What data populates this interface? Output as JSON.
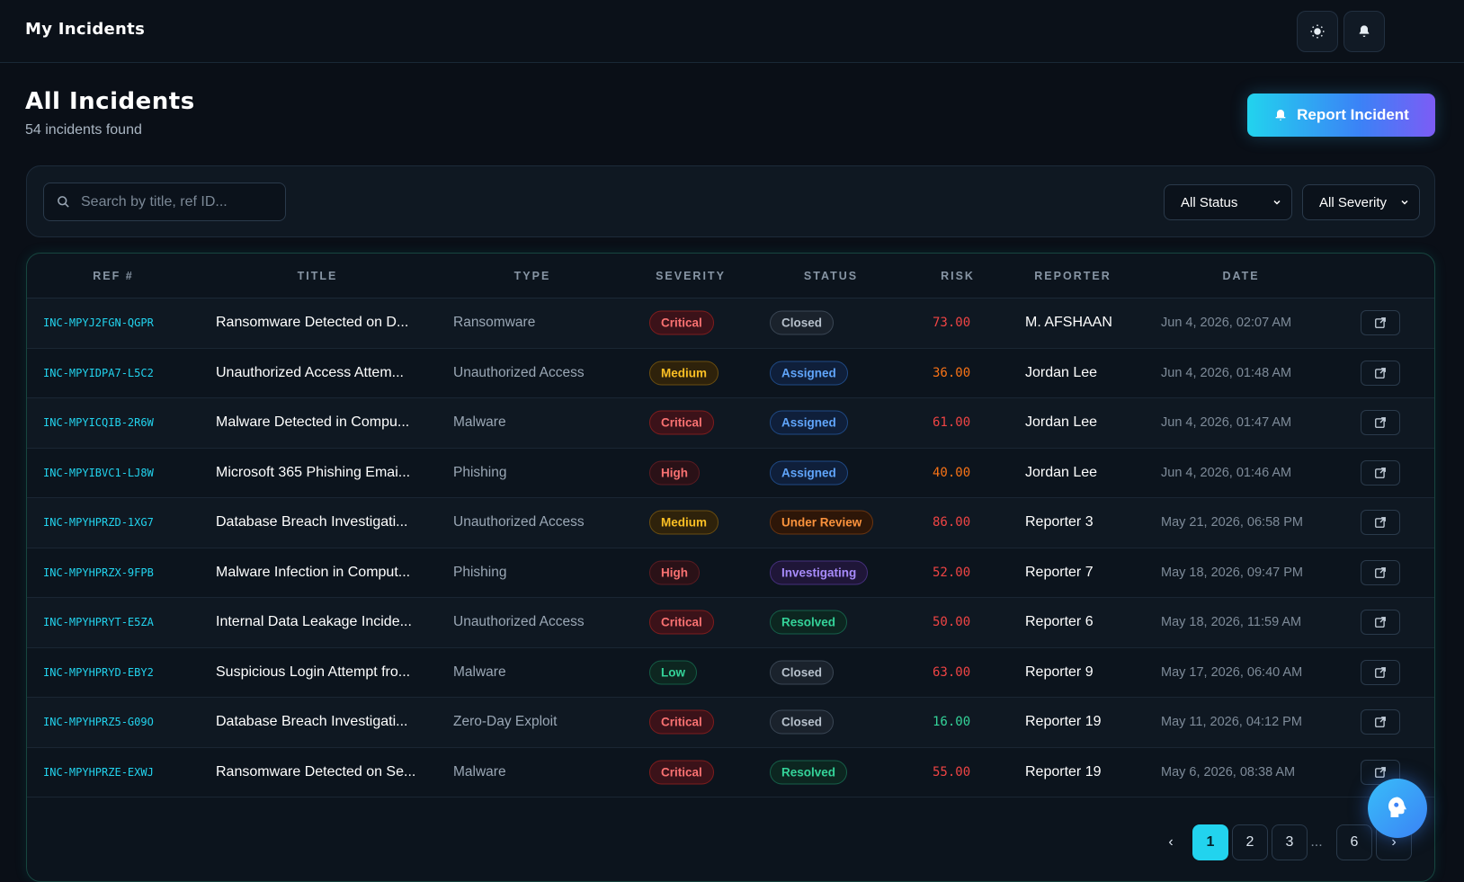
{
  "header": {
    "title": "My Incidents",
    "theme_icon": "sun-icon",
    "notif_icon": "bell-icon"
  },
  "page": {
    "title": "All Incidents",
    "count_text": "54 incidents found",
    "report_label": "Report Incident"
  },
  "filters": {
    "search_placeholder": "Search by title, ref ID...",
    "status_value": "All Status",
    "severity_value": "All Severity"
  },
  "table": {
    "headers": [
      "REF #",
      "TITLE",
      "TYPE",
      "SEVERITY",
      "STATUS",
      "RISK",
      "REPORTER",
      "DATE"
    ],
    "rows": [
      {
        "ref": "INC-MPYJ2FGN-QGPR",
        "title": "Ransomware Detected on D...",
        "type": "Ransomware",
        "severity": "Critical",
        "status": "Closed",
        "risk": "73.00",
        "reporter": "M. AFSHAAN",
        "date": "Jun 4, 2026, 02:07 AM"
      },
      {
        "ref": "INC-MPYIDPA7-L5C2",
        "title": "Unauthorized Access Attem...",
        "type": "Unauthorized Access",
        "severity": "Medium",
        "status": "Assigned",
        "risk": "36.00",
        "reporter": "Jordan Lee",
        "date": "Jun 4, 2026, 01:48 AM"
      },
      {
        "ref": "INC-MPYICQIB-2R6W",
        "title": "Malware Detected in Compu...",
        "type": "Malware",
        "severity": "Critical",
        "status": "Assigned",
        "risk": "61.00",
        "reporter": "Jordan Lee",
        "date": "Jun 4, 2026, 01:47 AM"
      },
      {
        "ref": "INC-MPYIBVC1-LJ8W",
        "title": "Microsoft 365 Phishing Emai...",
        "type": "Phishing",
        "severity": "High",
        "status": "Assigned",
        "risk": "40.00",
        "reporter": "Jordan Lee",
        "date": "Jun 4, 2026, 01:46 AM"
      },
      {
        "ref": "INC-MPYHPRZD-1XG7",
        "title": "Database Breach Investigati...",
        "type": "Unauthorized Access",
        "severity": "Medium",
        "status": "Under Review",
        "risk": "86.00",
        "reporter": "Reporter 3",
        "date": "May 21, 2026, 06:58 PM"
      },
      {
        "ref": "INC-MPYHPRZX-9FPB",
        "title": "Malware Infection in Comput...",
        "type": "Phishing",
        "severity": "High",
        "status": "Investigating",
        "risk": "52.00",
        "reporter": "Reporter 7",
        "date": "May 18, 2026, 09:47 PM"
      },
      {
        "ref": "INC-MPYHPRYT-E5ZA",
        "title": "Internal Data Leakage Incide...",
        "type": "Unauthorized Access",
        "severity": "Critical",
        "status": "Resolved",
        "risk": "50.00",
        "reporter": "Reporter 6",
        "date": "May 18, 2026, 11:59 AM"
      },
      {
        "ref": "INC-MPYHPRYD-EBY2",
        "title": "Suspicious Login Attempt fro...",
        "type": "Malware",
        "severity": "Low",
        "status": "Closed",
        "risk": "63.00",
        "reporter": "Reporter 9",
        "date": "May 17, 2026, 06:40 AM"
      },
      {
        "ref": "INC-MPYHPRZ5-G09O",
        "title": "Database Breach Investigati...",
        "type": "Zero-Day Exploit",
        "severity": "Critical",
        "status": "Closed",
        "risk": "16.00",
        "reporter": "Reporter 19",
        "date": "May 11, 2026, 04:12 PM"
      },
      {
        "ref": "INC-MPYHPRZE-EXWJ",
        "title": "Ransomware Detected on Se...",
        "type": "Malware",
        "severity": "Critical",
        "status": "Resolved",
        "risk": "55.00",
        "reporter": "Reporter 19",
        "date": "May 6, 2026, 08:38 AM"
      }
    ]
  },
  "pagination": {
    "prev": "‹",
    "pages": [
      "1",
      "2",
      "3"
    ],
    "ellipsis": "...",
    "last": "6",
    "next": "›",
    "current": "1"
  },
  "colors": {
    "accent": "#22d3ee",
    "severity": {
      "Critical": {
        "fg": "#f87171",
        "bg": "#3b1219",
        "bd": "#7f1d1d"
      },
      "High": {
        "fg": "#f87171",
        "bg": "#2a1117",
        "bd": "#5b1c22"
      },
      "Medium": {
        "fg": "#fbbf24",
        "bg": "#2e220b",
        "bd": "#6b4e10"
      },
      "Low": {
        "fg": "#34d399",
        "bg": "#0d2620",
        "bd": "#145c45"
      }
    },
    "status": {
      "Closed": {
        "fg": "#b6c0cb",
        "bg": "#1a222c",
        "bd": "#3a4654"
      },
      "Assigned": {
        "fg": "#60a5fa",
        "bg": "#0f1f3a",
        "bd": "#1f4a86"
      },
      "Under Review": {
        "fg": "#fb923c",
        "bg": "#2d1608",
        "bd": "#6b3510"
      },
      "Investigating": {
        "fg": "#a78bfa",
        "bg": "#1f1638",
        "bd": "#45307d"
      },
      "Resolved": {
        "fg": "#34d399",
        "bg": "#0c2620",
        "bd": "#16604a"
      }
    }
  }
}
